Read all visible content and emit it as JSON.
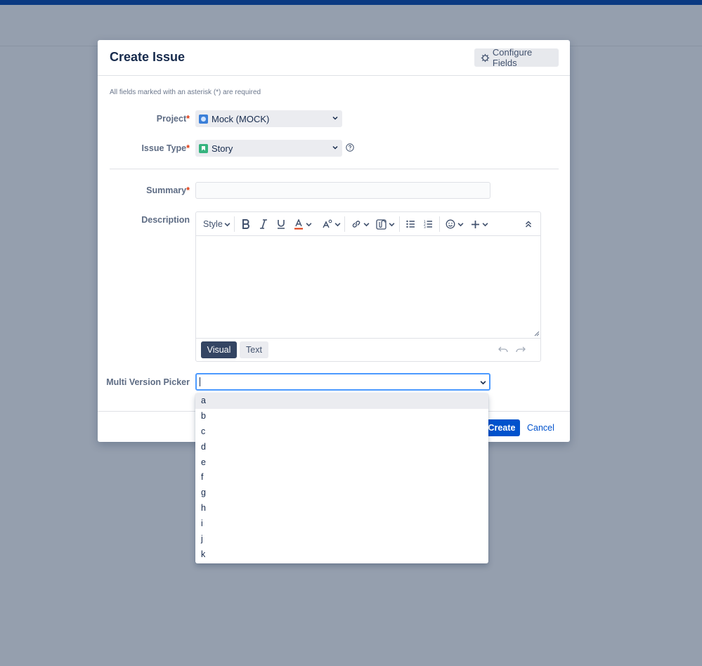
{
  "dialog": {
    "title": "Create Issue",
    "configure_fields_label": "Configure Fields",
    "required_note": "All fields marked with an asterisk (*) are required"
  },
  "fields": {
    "project": {
      "label": "Project",
      "value": "Mock (MOCK)"
    },
    "issue_type": {
      "label": "Issue Type",
      "value": "Story"
    },
    "summary": {
      "label": "Summary",
      "value": ""
    },
    "description": {
      "label": "Description",
      "style_label": "Style"
    },
    "multi_version_picker": {
      "label": "Multi Version Picker",
      "value": ""
    }
  },
  "editor": {
    "modes": {
      "visual": "Visual",
      "text": "Text"
    },
    "toolbar_icons": [
      "bold-icon",
      "italic-icon",
      "underline-icon",
      "text-color-icon",
      "text-style-icon",
      "link-icon",
      "attachment-icon",
      "bullet-list-icon",
      "numbered-list-icon",
      "emoji-icon",
      "insert-more-icon",
      "collapse-icon",
      "undo-icon",
      "redo-icon"
    ]
  },
  "footer": {
    "create_label": "Create",
    "cancel_label": "Cancel"
  },
  "dropdown": {
    "options": [
      "a",
      "b",
      "c",
      "d",
      "e",
      "f",
      "g",
      "h",
      "i",
      "j",
      "k"
    ],
    "highlighted": "a"
  },
  "colors": {
    "primary": "#0052cc",
    "header_bar": "#0b3a82",
    "overlay": "#959fae",
    "required": "#de350b"
  }
}
